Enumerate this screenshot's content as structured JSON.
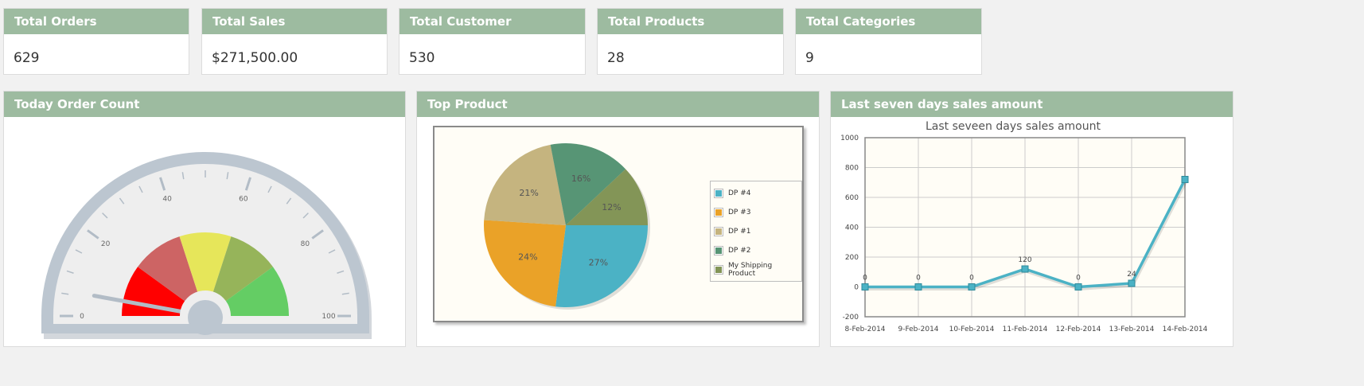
{
  "stats": [
    {
      "title": "Total Orders",
      "value": "629"
    },
    {
      "title": "Total Sales",
      "value": "$271,500.00"
    },
    {
      "title": "Total Customer",
      "value": "530"
    },
    {
      "title": "Total Products",
      "value": "28"
    },
    {
      "title": "Total Categories",
      "value": "9"
    }
  ],
  "gauge_panel": {
    "title": "Today Order Count",
    "gauge": {
      "min": 0,
      "max": 100,
      "value": 0,
      "tick_labels": [
        "0",
        "20",
        "40",
        "60",
        "80",
        "100"
      ],
      "bands": [
        {
          "from": 0,
          "to": 20,
          "color": "#ff0000"
        },
        {
          "from": 20,
          "to": 40,
          "color": "#cd6464"
        },
        {
          "from": 40,
          "to": 60,
          "color": "#e6e65a"
        },
        {
          "from": 60,
          "to": 80,
          "color": "#96b45a"
        },
        {
          "from": 80,
          "to": 100,
          "color": "#64cd64"
        }
      ]
    }
  },
  "pie_panel": {
    "title": "Top Product"
  },
  "line_panel": {
    "title": "Last seven days sales amount"
  },
  "chart_data": [
    {
      "type": "pie",
      "labels": [
        "DP #4",
        "DP #3",
        "DP #1",
        "DP #2",
        "My Shipping Product"
      ],
      "values": [
        27,
        24,
        21,
        16,
        12
      ],
      "value_labels": [
        "27%",
        "24%",
        "21%",
        "16%",
        "12%"
      ],
      "colors": [
        "#4bb2c5",
        "#eaa228",
        "#c5b47f",
        "#579575",
        "#839557"
      ],
      "legend_position": "right"
    },
    {
      "type": "line",
      "title": "Last seveen days sales amount",
      "categories": [
        "8-Feb-2014",
        "9-Feb-2014",
        "10-Feb-2014",
        "11-Feb-2014",
        "12-Feb-2014",
        "13-Feb-2014",
        "14-Feb-2014"
      ],
      "series": [
        {
          "values": [
            0,
            0,
            0,
            120,
            0,
            24,
            720
          ],
          "color": "#4bb2c5"
        }
      ],
      "point_labels": [
        "0",
        "0",
        "0",
        "120",
        "0",
        "24",
        ""
      ],
      "ylim": [
        -200,
        1000
      ],
      "yticks": [
        "-200",
        "0",
        "200",
        "400",
        "600",
        "800",
        "1000"
      ],
      "grid": true
    }
  ]
}
